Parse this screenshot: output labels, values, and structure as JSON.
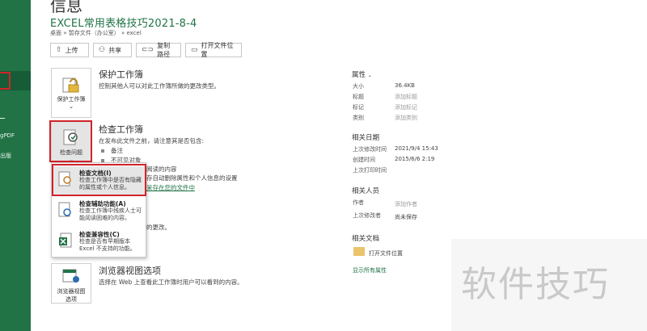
{
  "nav": {
    "items": [
      {
        "label": "gPDF"
      },
      {
        "label": "出版"
      }
    ]
  },
  "page_title": "信息",
  "document": {
    "title": "EXCEL常用表格技巧2021-8-4",
    "path": [
      "桌面",
      "暂存文件（办公室）",
      "excel"
    ]
  },
  "toolbar": {
    "upload": "上传",
    "share": "共享",
    "copy_path": "复制路径",
    "open_location": "打开文件位置"
  },
  "sections": {
    "protect": {
      "button": "保护工作簿",
      "title": "保护工作簿",
      "desc": "控制其他人可以对此工作簿所做的更改类型。"
    },
    "inspect": {
      "button": "检查问题",
      "title": "检查工作簿",
      "desc": "在发布此文件之前，请注意其是否包含:",
      "bullets": [
        "备注",
        "不可见对象"
      ],
      "partial_1": "阅读的内容",
      "partial_2": "存自动删除属性和个人信息的设置",
      "link": "呆存在您的文件中",
      "partial_3": "的更改。"
    },
    "browser": {
      "button_line1": "浏览器视图",
      "button_line2": "选项",
      "title": "浏览器视图选项",
      "desc": "选择在 Web 上查看此工作簿时用户可以看到的内容。"
    }
  },
  "dropdown": {
    "items": [
      {
        "title": "检查文档(I)",
        "desc": "检查工作簿中是否有隐藏的属性或个人信息。"
      },
      {
        "title": "检查辅助功能(A)",
        "desc": "检查工作簿中残疾人士可能阅读困难的内容。"
      },
      {
        "title": "检查兼容性(C)",
        "desc": "检查是否有早期版本 Excel 不支持的功能。"
      }
    ]
  },
  "properties": {
    "heading": "属性",
    "rows": [
      {
        "key": "大小",
        "value": "36.4KB"
      },
      {
        "key": "标题",
        "value": "添加标题"
      },
      {
        "key": "标记",
        "value": "添加标记"
      },
      {
        "key": "类别",
        "value": "添加类别"
      }
    ]
  },
  "dates": {
    "heading": "相关日期",
    "rows": [
      {
        "key": "上次修改时间",
        "value": "2021/9/4 15:43"
      },
      {
        "key": "创建时间",
        "value": "2015/6/6 2:19"
      },
      {
        "key": "上次打印时间",
        "value": ""
      }
    ]
  },
  "people": {
    "heading": "相关人员",
    "author_key": "作者",
    "author_value": "添加作者",
    "modifier_key": "上次修改者",
    "modifier_value": "尚未保存"
  },
  "related_docs": {
    "heading": "相关文档",
    "open_location": "打开文件位置",
    "show_all": "显示所有属性"
  },
  "watermark": "软件技巧",
  "colors": {
    "accent": "#217346",
    "highlight": "#d0242a"
  }
}
